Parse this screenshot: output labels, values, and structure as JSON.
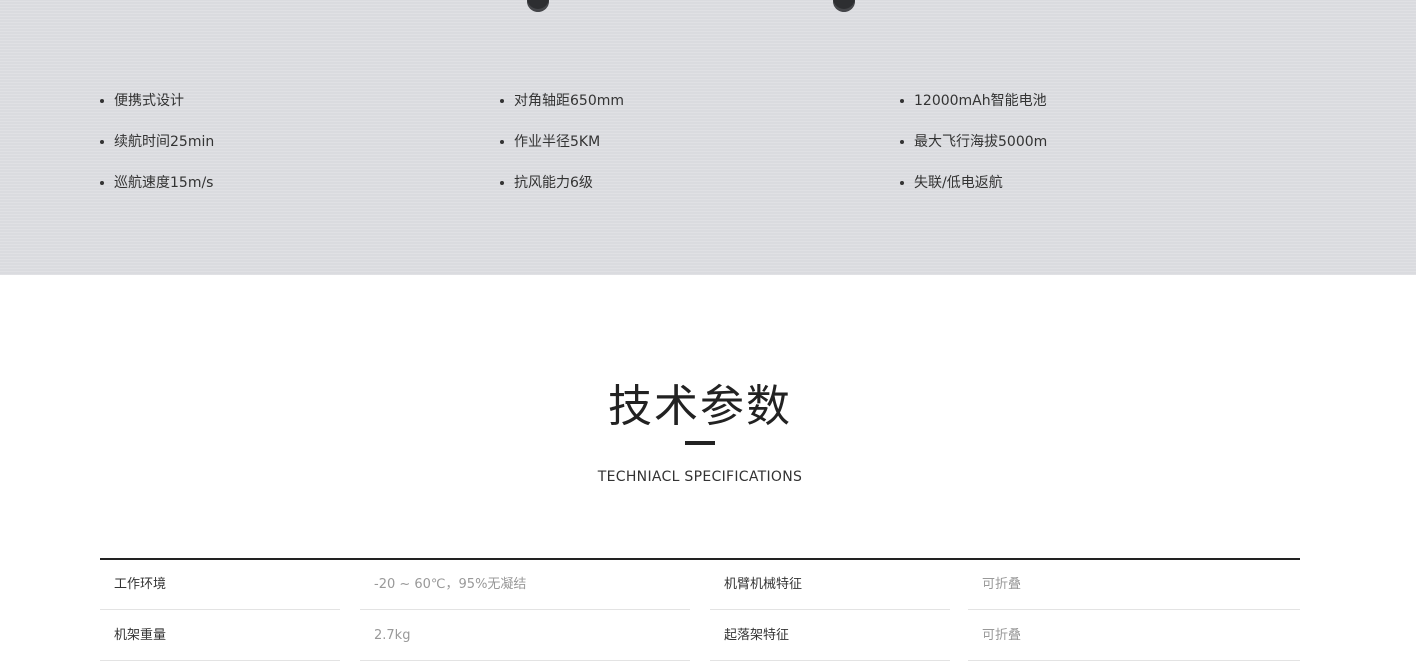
{
  "features": {
    "columns": [
      [
        "便携式设计",
        "续航时间25min",
        "巡航速度15m/s"
      ],
      [
        "对角轴距650mm",
        "作业半径5KM",
        "抗风能力6级"
      ],
      [
        "12000mAh智能电池",
        "最大飞行海拔5000m",
        "失联/低电返航"
      ]
    ]
  },
  "specs": {
    "title": "技术参数",
    "subtitle": "TECHNIACL SPECIFICATIONS",
    "rows": [
      [
        {
          "label": "工作环境",
          "value": "-20 ~ 60℃，95%无凝结"
        },
        {
          "label": "机臂机械特征",
          "value": "可折叠"
        }
      ],
      [
        {
          "label": "机架重量",
          "value": "2.7kg"
        },
        {
          "label": "起落架特征",
          "value": "可折叠"
        }
      ]
    ]
  }
}
